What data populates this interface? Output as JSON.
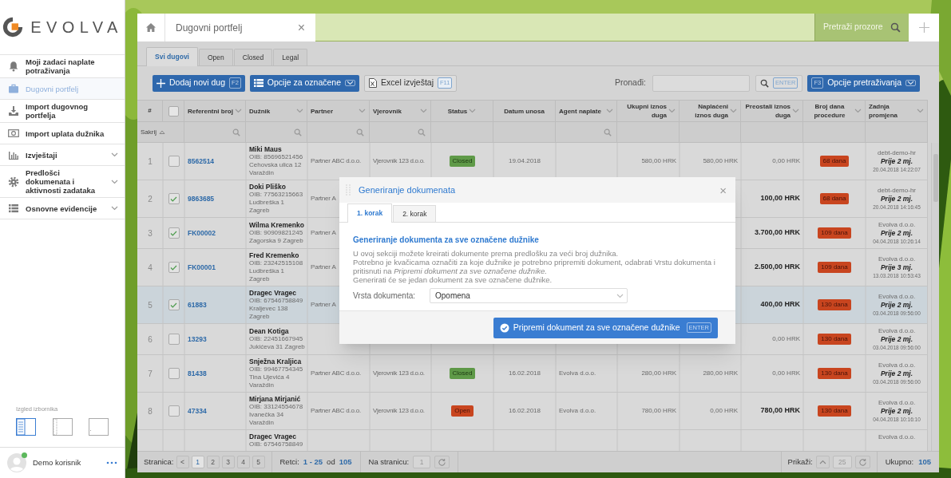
{
  "sidebar": {
    "logo": "EVOLVA",
    "items": [
      {
        "label": "Moji zadaci naplate potraživanja",
        "selected": false,
        "expandable": false
      },
      {
        "label": "Dugovni portfelj",
        "selected": true,
        "expandable": false
      },
      {
        "label": "Import dugovnog portfelja",
        "selected": false,
        "expandable": false
      },
      {
        "label": "Import uplata dužnika",
        "selected": false,
        "expandable": false
      },
      {
        "label": "Izvještaji",
        "selected": false,
        "expandable": true
      },
      {
        "label": "Predlošci dokumenata i aktivnosti zadataka",
        "selected": false,
        "expandable": true
      },
      {
        "label": "Osnovne evidencije",
        "selected": false,
        "expandable": true
      }
    ],
    "layout_label": "Izgled izbornika",
    "layouts": [
      {
        "selected": true
      },
      {
        "selected": false
      },
      {
        "selected": false
      }
    ],
    "user": {
      "name": "Demo korisnik",
      "online": true
    }
  },
  "window_tab": {
    "label": "Dugovni portfelj",
    "close": "×"
  },
  "window_search": {
    "placeholder": "Pretraži prozore"
  },
  "sub_tabs": [
    {
      "label": "Svi dugovi",
      "selected": true
    },
    {
      "label": "Open",
      "selected": false
    },
    {
      "label": "Closed",
      "selected": false
    },
    {
      "label": "Legal",
      "selected": false
    }
  ],
  "toolbar": {
    "buttons": [
      {
        "label": "Dodaj novi dug",
        "key": "F2",
        "kind": "add"
      },
      {
        "label": "Opcije za označene",
        "kind": "options"
      },
      {
        "label": "Excel izvještaj",
        "key": "F11",
        "kind": "excel"
      }
    ],
    "find_label": "Pronađi:",
    "find_key": "ENTER",
    "search_options": {
      "key": "F3",
      "label": "Opcije pretraživanja"
    }
  },
  "table": {
    "header_checkbox": {
      "checked": false
    },
    "hide_label": "Sakrij",
    "columns": [
      {
        "label": "#",
        "sort": false,
        "filter": false
      },
      {
        "label": "Referentni broj",
        "sort": true,
        "filter": true
      },
      {
        "label": "Dužnik",
        "sort": true,
        "filter": true
      },
      {
        "label": "Partner",
        "sort": true,
        "filter": true
      },
      {
        "label": "Vjerovnik",
        "sort": true,
        "filter": true
      },
      {
        "label": "Status",
        "sort": true,
        "filter": false
      },
      {
        "label": "Datum unosa",
        "sort": false,
        "filter": false
      },
      {
        "label": "Agent naplate",
        "sort": true,
        "filter": true
      },
      {
        "label": "Ukupni iznos duga",
        "sort": true,
        "filter": false
      },
      {
        "label": "Naplaćeni iznos duga",
        "sort": true,
        "filter": false
      },
      {
        "label": "Preostali iznos duga",
        "sort": true,
        "filter": false
      },
      {
        "label": "Broj dana procedure",
        "sort": true,
        "filter": false
      },
      {
        "label": "Zadnja promjena",
        "sort": true,
        "filter": false
      }
    ],
    "rows": [
      {
        "number": "1",
        "checked": false,
        "selected": false,
        "ref": "8562514",
        "name": "Miki Maus",
        "oib": "OIB: 85696521456",
        "address": [
          "Cehovska ulica 12",
          "Varaždin"
        ],
        "partner": "Partner ABC d.o.o.",
        "creditor": "Vjerovnik 123 d.o.o.",
        "status": {
          "label": "Closed",
          "kind": "closed"
        },
        "date": "19.04.2018",
        "total": "580,00 HRK",
        "paid": "580,00 HRK",
        "remaining": "0,00 HRK",
        "remaining_bold": false,
        "days": "68 dana",
        "changed_by": "debt-demo-hr",
        "ago": "Prije 2 mj.",
        "timestamp": "20.04.2018 14:22:07"
      },
      {
        "number": "2",
        "checked": true,
        "selected": false,
        "ref": "9863685",
        "name": "Doki Pliško",
        "oib": "OIB: 77563215663",
        "address": [
          "Ludbreška 1",
          "Zagreb"
        ],
        "partner": "Partner A",
        "remaining": "100,00 HRK",
        "remaining_bold": true,
        "days": "68 dana",
        "changed_by": "debt-demo-hr",
        "ago": "Prije 2 mj.",
        "timestamp": "20.04.2018 14:16:45"
      },
      {
        "number": "3",
        "checked": true,
        "selected": false,
        "ref": "FK00002",
        "name": "Wilma Kremenko",
        "oib": "OIB: 90909821245",
        "address": [
          "Zagorska 9 Zagreb"
        ],
        "partner": "Partner A",
        "remaining": "3.700,00 HRK",
        "remaining_bold": true,
        "days": "109 dana",
        "changed_by": "Evolva d.o.o.",
        "ago": "Prije 2 mj.",
        "timestamp": "04.04.2018 10:26:14"
      },
      {
        "number": "4",
        "checked": true,
        "selected": false,
        "ref": "FK00001",
        "name": "Fred Kremenko",
        "oib": "OIB: 23242515108",
        "address": [
          "Ludbreška 1",
          "Zagreb"
        ],
        "partner": "Partner A",
        "remaining": "2.500,00 HRK",
        "remaining_bold": true,
        "days": "109 dana",
        "changed_by": "Evolva d.o.o.",
        "ago": "Prije 3 mj.",
        "timestamp": "13.03.2018 10:53:43"
      },
      {
        "number": "5",
        "checked": true,
        "selected": true,
        "ref": "61883",
        "name": "Dragec Vragec",
        "oib": "OIB: 67546758849",
        "address": [
          "Kraljevec 138",
          "Zagreb"
        ],
        "partner": "Partner A",
        "remaining": "400,00 HRK",
        "remaining_bold": true,
        "days": "130 dana",
        "changed_by": "Evolva d.o.o.",
        "ago": "Prije 2 mj.",
        "timestamp": "03.04.2018 09:56:00"
      },
      {
        "number": "6",
        "checked": false,
        "selected": false,
        "ref": "13293",
        "name": "Dean Kotiga",
        "oib": "OIB: 22451667945",
        "address": [
          "Jukićeva 31 Zagreb"
        ],
        "remaining": "0,00 HRK",
        "remaining_bold": false,
        "days": "130 dana",
        "changed_by": "Evolva d.o.o.",
        "ago": "Prije 2 mj.",
        "timestamp": "03.04.2018 09:56:00"
      },
      {
        "number": "7",
        "checked": false,
        "selected": false,
        "ref": "81438",
        "name": "Snježna Kraljica",
        "oib": "OIB: 99467754345",
        "address": [
          "Tina Ujevića 4",
          "Varaždin"
        ],
        "partner": "Partner ABC d.o.o.",
        "creditor": "Vjerovnik 123 d.o.o.",
        "status": {
          "label": "Closed",
          "kind": "closed"
        },
        "date": "16.02.2018",
        "agent": "Evolva d.o.o.",
        "total": "280,00 HRK",
        "paid": "280,00 HRK",
        "remaining": "0,00 HRK",
        "remaining_bold": false,
        "days": "130 dana",
        "changed_by": "Evolva d.o.o.",
        "ago": "Prije 2 mj.",
        "timestamp": "03.04.2018 09:56:00"
      },
      {
        "number": "8",
        "checked": false,
        "selected": false,
        "ref": "47334",
        "name": "Mirjana Mirjanić",
        "oib": "OIB: 33124554678",
        "address": [
          "Ivanečka 34",
          "Varaždin"
        ],
        "partner": "Partner ABC d.o.o.",
        "creditor": "Vjerovnik 123 d.o.o.",
        "status": {
          "label": "Open",
          "kind": "open"
        },
        "date": "16.02.2018",
        "agent": "Evolva d.o.o.",
        "total": "780,00 HRK",
        "paid": "0,00 HRK",
        "remaining": "780,00 HRK",
        "remaining_bold": true,
        "days": "130 dana",
        "changed_by": "Evolva d.o.o.",
        "ago": "Prije 2 mj.",
        "timestamp": "04.04.2018 10:16:10"
      },
      {
        "name": "Dragec Vragec",
        "oib": "OIB: 67546758849",
        "changed_by": "Evolva d.o.o."
      }
    ]
  },
  "pager": {
    "page_label": "Stranica:",
    "prev": "<",
    "pages": [
      {
        "label": "1",
        "selected": true
      },
      {
        "label": "2",
        "selected": false
      },
      {
        "label": "3",
        "selected": false
      },
      {
        "label": "4",
        "selected": false
      },
      {
        "label": "5",
        "selected": false
      }
    ],
    "rows_label": "Retci:",
    "rows_range": "1 - 25",
    "of_label": "od",
    "rows_total": "105",
    "goto_label": "Na stranicu:",
    "goto_value": "1",
    "show_label": "Prikaži:",
    "page_size": "25",
    "total_label": "Ukupno:",
    "total": "105"
  },
  "modal": {
    "title": "Generiranje dokumenata",
    "close": "×",
    "tabs": [
      {
        "label": "1. korak",
        "selected": true
      },
      {
        "label": "2. korak",
        "selected": false
      }
    ],
    "heading": "Generiranje dokumenta za sve označene dužnike",
    "paragraphs": [
      "U ovoj sekciji možete kreirati dokumente prema predlošku za veći broj dužnika.",
      "Potrebno je kvačicama označiti za koje dužnike je potrebno pripremiti dokument, odabrati Vrstu dokumenta i pritisnuti na *Pripremi dokument za sve označene dužnike.*",
      "Generirati će se jedan dokument za sve označene dužnike."
    ],
    "field_label": "Vrsta dokumenta:",
    "field_value": "Opomena",
    "button": {
      "label": "Pripremi dokument za sve označene dužnike",
      "key": "ENTER"
    }
  }
}
